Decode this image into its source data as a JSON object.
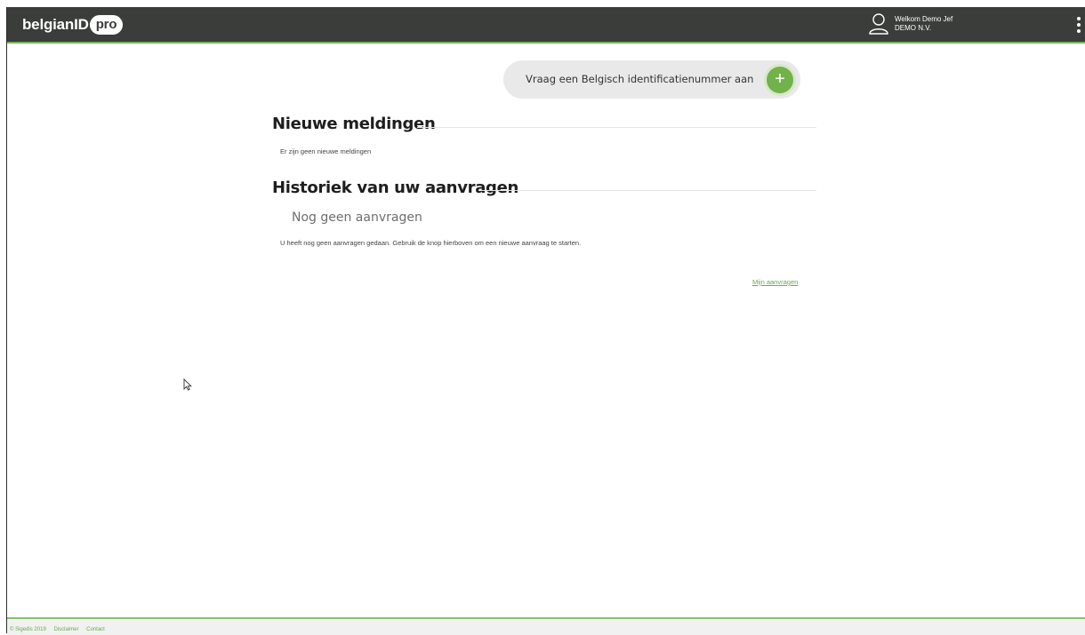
{
  "header": {
    "logo_text": "belgianID",
    "logo_badge": "pro",
    "user_greeting": "Welkom Demo Jef",
    "user_company": "DEMO N.V."
  },
  "cta": {
    "label": "Vraag een Belgisch identificatienummer aan",
    "icon": "plus-icon"
  },
  "notifications": {
    "title": "Nieuwe meldingen",
    "empty_text": "Er zijn geen nieuwe meldingen"
  },
  "history": {
    "title": "Historiek van uw aanvragen",
    "empty_title": "Nog geen aanvragen",
    "empty_text": "U heeft nog geen aanvragen gedaan. Gebruik de knop hierboven om een nieuwe aanvraag te starten.",
    "link": "Mijn aanvragen"
  },
  "footer": {
    "copyright": "© Sigedis 2019",
    "disclaimer": "Disclaimer",
    "contact": "Contact"
  },
  "colors": {
    "header_bg": "#3a3d39",
    "accent": "#72b24a"
  }
}
